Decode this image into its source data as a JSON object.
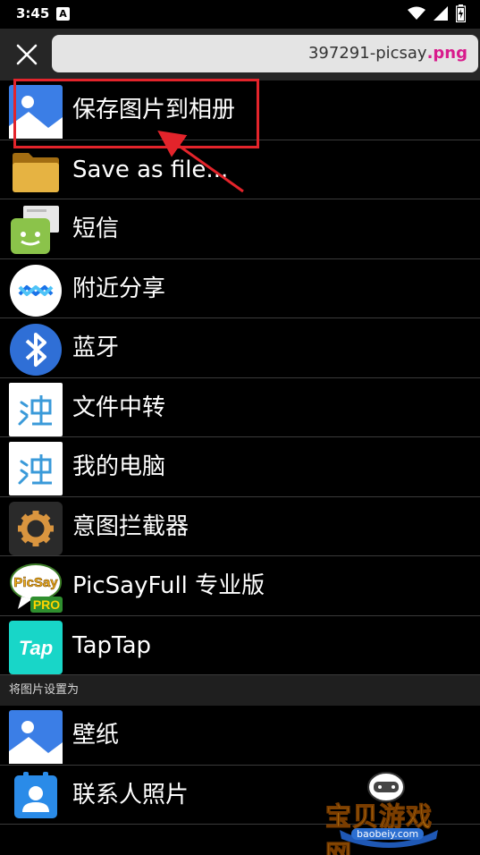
{
  "status": {
    "time": "3:45",
    "notification_letter": "A"
  },
  "header": {
    "filename_base": "397291-picsay",
    "filename_ext": ".png"
  },
  "share_items": [
    {
      "label": "保存图片到相册",
      "icon": "gallery-icon"
    },
    {
      "label": "Save as file...",
      "icon": "folder-icon"
    },
    {
      "label": "短信",
      "icon": "sms-icon"
    },
    {
      "label": "附近分享",
      "icon": "nearby-share-icon"
    },
    {
      "label": "蓝牙",
      "icon": "bluetooth-icon"
    },
    {
      "label": "文件中转",
      "icon": "file-transfer-icon"
    },
    {
      "label": "我的电脑",
      "icon": "my-computer-icon"
    },
    {
      "label": "意图拦截器",
      "icon": "intent-interceptor-icon"
    },
    {
      "label": "PicSayFull 专业版",
      "icon": "picsay-pro-icon"
    },
    {
      "label": "TapTap",
      "icon": "taptap-icon"
    }
  ],
  "set_as_section": {
    "title": "将图片设置为"
  },
  "set_as_items": [
    {
      "label": "壁纸",
      "icon": "gallery-icon"
    },
    {
      "label": "联系人照片",
      "icon": "contact-photo-icon"
    }
  ],
  "icon_text": {
    "picsay_logo": "PicSay",
    "picsay_badge": "PRO",
    "taptap_logo": "Tap"
  },
  "watermark": {
    "text": "宝贝游戏网",
    "url": "baobeiy.com"
  },
  "colors": {
    "highlight": "#e3242b",
    "extension": "#d81b8c",
    "accent_blue": "#2f80ed"
  }
}
